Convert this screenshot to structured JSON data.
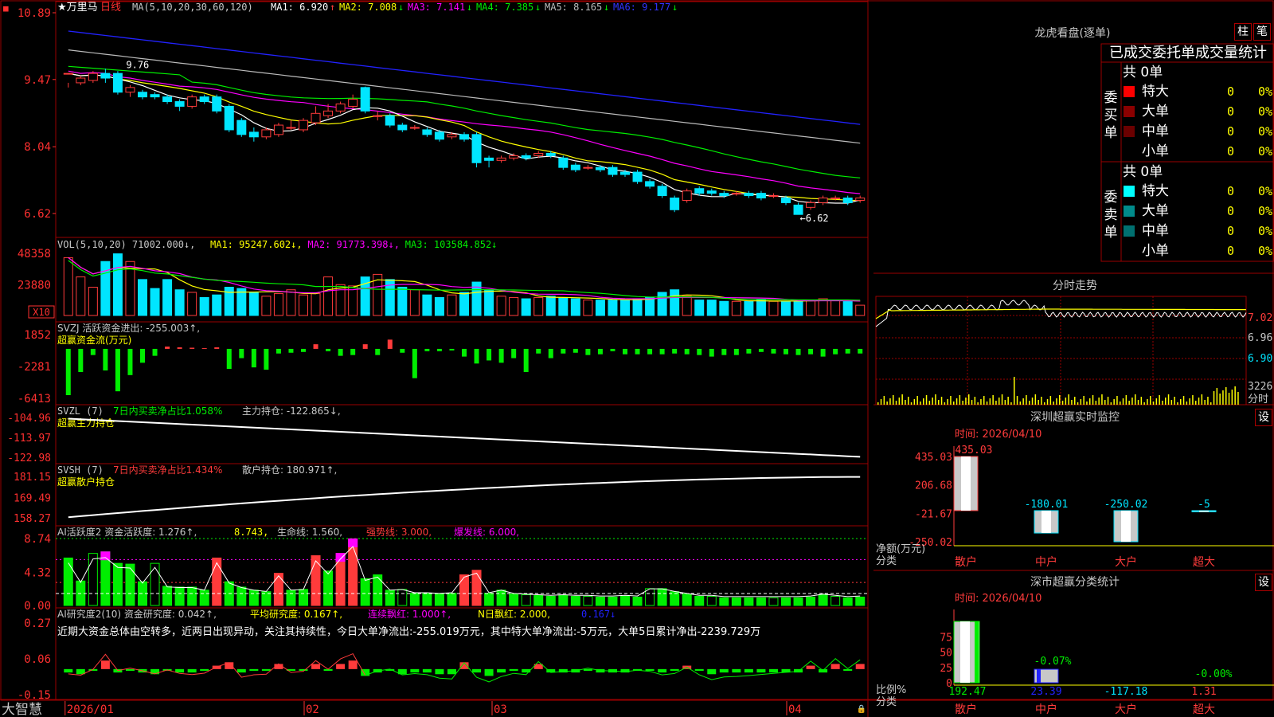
{
  "app": {
    "name": "大智慧"
  },
  "colors": {
    "up": "#ff3b3b",
    "down": "#00e5ff",
    "grid": "#9a0000",
    "axis": "#ff3030",
    "text": "#c8c8c8",
    "yellow": "#ffff00",
    "magenta": "#ff00ff",
    "green": "#00ee00",
    "white": "#ffffff",
    "blue": "#2222ff",
    "gray": "#bbbbbb",
    "dim": "#888888"
  },
  "main": {
    "stock": "★万里马",
    "period": "日线",
    "ma_label": "MA(5,10,20,30,60,120)",
    "ma_items": [
      {
        "label": "MA1:",
        "value": "6.920",
        "arrow": "↑",
        "color": "#ffffff"
      },
      {
        "label": "MA2:",
        "value": "7.008",
        "arrow": "↓",
        "color": "#ffff00"
      },
      {
        "label": "MA3:",
        "value": "7.141",
        "arrow": "↓",
        "color": "#ff00ff"
      },
      {
        "label": "MA4:",
        "value": "7.385",
        "arrow": "↓",
        "color": "#00ee00"
      },
      {
        "label": "MA5:",
        "value": "8.165",
        "arrow": "↓",
        "color": "#bbbbbb"
      },
      {
        "label": "MA6:",
        "value": "9.177",
        "arrow": "↓",
        "color": "#3333ff"
      }
    ],
    "y_ticks": [
      "10.89",
      "9.47",
      "8.04",
      "6.62"
    ],
    "hi_label": "9.76",
    "lo_label": "6.62"
  },
  "x_axis": {
    "labels": [
      "2026/01",
      "02",
      "03",
      "04"
    ]
  },
  "vol_panel": {
    "title": "VOL(5,10,20)",
    "value": "71002.000↓,",
    "items": [
      {
        "text": "MA1: 95247.602↓,",
        "color": "#ffff00"
      },
      {
        "text": "MA2: 91773.398↓,",
        "color": "#ff00ff"
      },
      {
        "text": "MA3: 103584.852↓",
        "color": "#00ee00"
      }
    ],
    "y_ticks": [
      "48358",
      "23880"
    ],
    "unit": "X10"
  },
  "svzj_panel": {
    "title": "SVZJ  活跃资金进出: -255.003↑,",
    "subtitle": "超赢资金流(万元)",
    "y_ticks": [
      "1852",
      "-2281",
      "-6413"
    ]
  },
  "svzl_panel": {
    "title": "SVZL (7)",
    "red_text": "7日内买卖净占比1.058%",
    "tail": "主力持仓: -122.865↓,",
    "subtitle": "超赢主力持仓",
    "y_ticks": [
      "-104.96",
      "-113.97",
      "-122.98"
    ]
  },
  "svsh_panel": {
    "title": "SVSH (7)",
    "red_text": "7日内买卖净占比1.434%",
    "tail": "散户持仓: 180.971↑,",
    "subtitle": "超赢散户持仓",
    "y_ticks": [
      "181.15",
      "169.49",
      "158.27"
    ]
  },
  "ai_active_panel": {
    "title": "AI活跃度2 资金活跃度: 1.276↑,",
    "val2": "8.743,",
    "life": "生命线: 1.560,",
    "strong": "强势线: 3.000,",
    "burst": "爆发线: 6.000,",
    "y_ticks": [
      "8.74",
      "4.32",
      "0.00"
    ]
  },
  "ai_research_panel": {
    "title": "AI研究度2(10) 资金研究度: 0.042↑,",
    "avg": "平均研究度: 0.167↑,",
    "streak": "连续飘红: 1.000↑,",
    "nday": "N日飘红: 2.000,",
    "last": "0.167↓",
    "note": "近期大资金总体由空转多，近两日出现异动，关注其持续性，今日大单净流出:-255.019万元，其中特大单净流出:-5万元，大单5日累计净出-2239.729万",
    "y_ticks": [
      "0.27",
      "0.06",
      "-0.15"
    ]
  },
  "longhu": {
    "title": "龙虎看盘(逐单)",
    "btn_zhu": "柱",
    "btn_bi": "笔",
    "header": "已成交委托单成交量统计",
    "buy_label": "委买单",
    "sell_label": "委卖单",
    "buy_total": "共 0单",
    "sell_total": "共 0单",
    "buy_rows": [
      {
        "name": "特大",
        "count": "0",
        "pct": "0%",
        "color": "#ff0000"
      },
      {
        "name": "大单",
        "count": "0",
        "pct": "0%",
        "color": "#8b0000"
      },
      {
        "name": "中单",
        "count": "0",
        "pct": "0%",
        "color": "#6b0000"
      },
      {
        "name": "小单",
        "count": "0",
        "pct": "0%",
        "color": ""
      }
    ],
    "sell_rows": [
      {
        "name": "特大",
        "count": "0",
        "pct": "0%",
        "color": "#00ffff"
      },
      {
        "name": "大单",
        "count": "0",
        "pct": "0%",
        "color": "#008b8b"
      },
      {
        "name": "中单",
        "count": "0",
        "pct": "0%",
        "color": "#007070"
      },
      {
        "name": "小单",
        "count": "0",
        "pct": "0%",
        "color": ""
      }
    ]
  },
  "intraday": {
    "title": "分时走势",
    "y_ticks": [
      "7.02",
      "6.96",
      "6.90"
    ],
    "vol_tick": "3226",
    "unit": "分时"
  },
  "sz_monitor": {
    "title": "深圳超赢实时监控",
    "btn": "设",
    "time": "时间: 2026/04/10",
    "y_ticks": [
      "435.03",
      "206.68",
      "-21.67",
      "-250.02"
    ],
    "ylabel": "净额(万元)",
    "xlabel": "分类",
    "categories": [
      "散户",
      "中户",
      "大户",
      "超大"
    ],
    "values": [
      435.03,
      -180.01,
      -250.02,
      -5
    ],
    "value_labels": [
      "435.03",
      "-180.01",
      "-250.02",
      "-5"
    ]
  },
  "sz_class": {
    "title": "深市超赢分类统计",
    "btn": "设",
    "time": "时间: 2026/04/10",
    "y_ticks": [
      "75",
      "50",
      "25",
      "0"
    ],
    "ylabel": "比例%",
    "xlabel": "分类",
    "categories": [
      "散户",
      "中户",
      "大户",
      "超大"
    ],
    "bottom_values": [
      "192.47",
      "23.39",
      "-117.18",
      "1.31"
    ],
    "annotations": [
      "-0.07%",
      "-0.00%"
    ]
  },
  "chart_data": [
    {
      "type": "candlestick",
      "title": "★万里马 日线",
      "ylim": [
        6.2,
        10.89
      ],
      "candles": [
        [
          9.6,
          9.6,
          9.4,
          9.3
        ],
        [
          9.4,
          9.5,
          9.55,
          9.35
        ],
        [
          9.45,
          9.6,
          9.65,
          9.4
        ],
        [
          9.6,
          9.5,
          9.7,
          9.4
        ],
        [
          9.6,
          9.2,
          9.65,
          9.15
        ],
        [
          9.2,
          9.3,
          9.35,
          9.1
        ],
        [
          9.2,
          9.1,
          9.25,
          9.05
        ],
        [
          9.15,
          9.1,
          9.2,
          9.05
        ],
        [
          9.1,
          9.0,
          9.15,
          8.95
        ],
        [
          9.0,
          8.9,
          9.05,
          8.8
        ],
        [
          8.9,
          9.1,
          9.15,
          8.85
        ],
        [
          9.1,
          9.0,
          9.15,
          8.95
        ],
        [
          9.1,
          8.8,
          9.15,
          8.75
        ],
        [
          8.9,
          8.4,
          8.95,
          8.35
        ],
        [
          8.6,
          8.3,
          8.65,
          8.25
        ],
        [
          8.35,
          8.25,
          8.45,
          8.15
        ],
        [
          8.25,
          8.4,
          8.45,
          8.2
        ],
        [
          8.3,
          8.5,
          8.55,
          8.25
        ],
        [
          8.45,
          8.45,
          8.6,
          8.4
        ],
        [
          8.4,
          8.6,
          8.65,
          8.35
        ],
        [
          8.55,
          8.75,
          8.9,
          8.5
        ],
        [
          8.7,
          8.8,
          8.95,
          8.65
        ],
        [
          8.8,
          8.95,
          9.0,
          8.75
        ],
        [
          8.9,
          9.05,
          9.15,
          8.85
        ],
        [
          9.3,
          8.8,
          9.32,
          8.75
        ],
        [
          8.7,
          8.7,
          8.8,
          8.6
        ],
        [
          8.7,
          8.5,
          8.75,
          8.45
        ],
        [
          8.5,
          8.4,
          8.55,
          8.35
        ],
        [
          8.45,
          8.45,
          8.5,
          8.4
        ],
        [
          8.4,
          8.3,
          8.45,
          8.25
        ],
        [
          8.35,
          8.2,
          8.4,
          8.15
        ],
        [
          8.25,
          8.3,
          8.35,
          8.2
        ],
        [
          8.3,
          8.2,
          8.35,
          8.15
        ],
        [
          8.3,
          7.7,
          8.35,
          7.6
        ],
        [
          7.8,
          7.75,
          7.85,
          7.6
        ],
        [
          7.75,
          7.8,
          7.85,
          7.7
        ],
        [
          7.8,
          7.85,
          7.9,
          7.75
        ],
        [
          7.85,
          7.8,
          7.9,
          7.75
        ],
        [
          7.85,
          7.9,
          7.95,
          7.8
        ],
        [
          7.9,
          7.85,
          7.95,
          7.8
        ],
        [
          7.8,
          7.6,
          7.85,
          7.55
        ],
        [
          7.65,
          7.55,
          7.7,
          7.5
        ],
        [
          7.6,
          7.6,
          7.65,
          7.55
        ],
        [
          7.6,
          7.55,
          7.65,
          7.5
        ],
        [
          7.6,
          7.45,
          7.65,
          7.4
        ],
        [
          7.5,
          7.45,
          7.55,
          7.4
        ],
        [
          7.5,
          7.3,
          7.55,
          7.25
        ],
        [
          7.3,
          7.2,
          7.35,
          7.15
        ],
        [
          7.2,
          7.0,
          7.25,
          6.95
        ],
        [
          6.95,
          6.7,
          7.0,
          6.65
        ],
        [
          6.9,
          7.1,
          7.15,
          6.85
        ],
        [
          7.15,
          7.05,
          7.2,
          7.0
        ],
        [
          7.1,
          7.05,
          7.15,
          7.0
        ],
        [
          7.05,
          7.0,
          7.1,
          6.95
        ],
        [
          7.05,
          7.05,
          7.1,
          7.0
        ],
        [
          7.05,
          7.0,
          7.1,
          6.95
        ],
        [
          7.05,
          6.95,
          7.1,
          6.9
        ],
        [
          7.0,
          7.0,
          7.05,
          6.95
        ],
        [
          6.95,
          6.85,
          7.0,
          6.8
        ],
        [
          6.8,
          6.6,
          6.85,
          6.62
        ],
        [
          6.75,
          6.85,
          6.9,
          6.7
        ],
        [
          6.85,
          6.95,
          7.0,
          6.8
        ],
        [
          6.95,
          6.95,
          7.0,
          6.9
        ],
        [
          6.95,
          6.85,
          7.0,
          6.8
        ],
        [
          6.9,
          6.95,
          7.0,
          6.85
        ]
      ]
    },
    {
      "type": "bar",
      "title": "VOL(5,10,20)",
      "ylim": [
        0,
        48358
      ],
      "values": [
        45000,
        30000,
        22000,
        42000,
        48000,
        42000,
        28000,
        21000,
        28000,
        20000,
        18000,
        14000,
        16000,
        22000,
        21000,
        18000,
        15000,
        17000,
        20000,
        16000,
        17000,
        30000,
        24000,
        23000,
        30000,
        32000,
        28000,
        22000,
        20000,
        16000,
        14000,
        16000,
        18000,
        26000,
        20000,
        15000,
        14000,
        13000,
        14000,
        15000,
        14000,
        13000,
        12000,
        12000,
        12000,
        12000,
        13000,
        14000,
        18000,
        20000,
        15000,
        12000,
        12000,
        11000,
        11000,
        11000,
        12000,
        11000,
        11000,
        11000,
        12000,
        13000,
        12000,
        11000,
        8000
      ]
    },
    {
      "type": "bar",
      "title": "超赢资金流(万元)",
      "ylim": [
        -6413,
        1852
      ],
      "values": [
        -6000,
        -3000,
        -800,
        -2800,
        -5500,
        -3400,
        -1800,
        -900,
        300,
        200,
        150,
        100,
        200,
        -2600,
        -1200,
        -2400,
        -2700,
        -600,
        -500,
        -400,
        600,
        -300,
        -900,
        -800,
        600,
        -800,
        1200,
        -500,
        -3800,
        -300,
        -300,
        -200,
        -1000,
        -1900,
        -1500,
        -1800,
        -1200,
        -3000,
        -600,
        -1200,
        -600,
        -500,
        -800,
        -700,
        -300,
        -700,
        -700,
        -700,
        -700,
        -600,
        -700,
        -800,
        -1000,
        -800,
        -800,
        -600,
        -400,
        -600,
        -700,
        -800,
        -700,
        -1000,
        -700,
        -600,
        -600
      ]
    },
    {
      "type": "area",
      "title": "AI活跃度2",
      "ylim": [
        0,
        8.74
      ],
      "values": [
        6.2,
        3.2,
        6.8,
        7.0,
        5.5,
        5.4,
        3.1,
        5.5,
        2.5,
        2.4,
        2.4,
        2.0,
        6.2,
        3.1,
        2.4,
        2.0,
        1.8,
        4.2,
        2.0,
        2.1,
        6.5,
        4.5,
        6.8,
        8.7,
        3.5,
        4.0,
        2.0,
        2.1,
        1.6,
        1.6,
        1.5,
        1.6,
        4.0,
        4.6,
        1.6,
        2.0,
        1.5,
        1.4,
        1.3,
        1.2,
        1.3,
        1.2,
        1.2,
        1.1,
        1.1,
        1.2,
        1.1,
        2.2,
        2.2,
        1.8,
        1.5,
        1.2,
        1.2,
        1.0,
        1.0,
        1.0,
        1.0,
        1.0,
        1.0,
        1.0,
        1.1,
        1.4,
        1.2,
        1.0,
        1.1
      ],
      "strong_line": 3.0,
      "burst_line": 6.0
    },
    {
      "type": "bar",
      "title": "AI研究度2(10)",
      "ylim": [
        -0.15,
        0.27
      ],
      "values": [
        -0.02,
        -0.03,
        -0.01,
        0.05,
        -0.02,
        -0.01,
        -0.02,
        -0.03,
        -0.01,
        -0.02,
        -0.02,
        -0.01,
        0.02,
        0.04,
        -0.02,
        -0.01,
        -0.01,
        0.03,
        -0.01,
        -0.01,
        0.03,
        -0.01,
        0.03,
        0.05,
        -0.04,
        -0.02,
        -0.01,
        -0.03,
        -0.02,
        -0.02,
        -0.03,
        -0.03,
        0.04,
        -0.02,
        -0.04,
        -0.02,
        -0.01,
        -0.02,
        0.03,
        -0.02,
        -0.02,
        -0.02,
        -0.01,
        -0.02,
        -0.02,
        -0.02,
        -0.01,
        -0.01,
        -0.02,
        -0.01,
        0.02,
        -0.01,
        -0.03,
        -0.02,
        -0.02,
        -0.02,
        -0.02,
        -0.02,
        -0.02,
        -0.02,
        0.02,
        -0.02,
        0.03,
        -0.01,
        0.03
      ]
    }
  ]
}
